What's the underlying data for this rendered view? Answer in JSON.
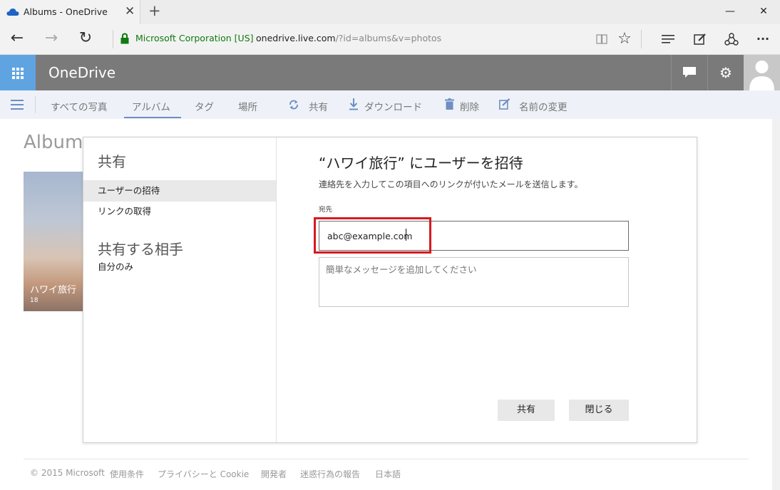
{
  "browser": {
    "tab_title": "Albums - OneDrive",
    "tab_close": "✕",
    "new_tab": "+",
    "window_controls": {
      "minimize": "—",
      "maximize": "☐",
      "close": "✕"
    },
    "nav": {
      "back": "←",
      "forward": "→",
      "refresh": "↻"
    },
    "certificate": "Microsoft Corporation [US]",
    "url_domain": "onedrive.live.com",
    "url_path": "/?id=albums&v=photos",
    "tools": {
      "reading": "📖",
      "favorite": "☆",
      "hub": "≡",
      "note": "✎",
      "share": "⇪",
      "more": "···"
    }
  },
  "header": {
    "app_name": "OneDrive",
    "chat_icon": "💬",
    "settings_icon": "⚙"
  },
  "commandbar": {
    "items": [
      "すべての写真",
      "アルバム",
      "タグ",
      "場所"
    ],
    "actions": {
      "share": "共有",
      "download": "ダウンロード",
      "delete": "削除",
      "rename": "名前の変更"
    }
  },
  "page": {
    "title": "Albums",
    "album": {
      "name": "ハワイ旅行",
      "count": "18"
    }
  },
  "dialog": {
    "left_heading": "共有",
    "nav": [
      "ユーザーの招待",
      "リンクの取得"
    ],
    "shared_with_heading": "共有する相手",
    "shared_with_value": "自分のみ",
    "title": "“ハワイ旅行” にユーザーを招待",
    "description": "連絡先を入力してこの項目へのリンクが付いたメールを送信します。",
    "to_label": "宛先",
    "to_value": "abc@example.com",
    "message_placeholder": "簡単なメッセージを追加してください",
    "share_button": "共有",
    "close_button": "閉じる"
  },
  "footer": [
    "© 2015 Microsoft",
    "使用条件",
    "プライバシーと Cookie",
    "開発者",
    "迷惑行為の報告",
    "日本語"
  ],
  "colors": {
    "accent": "#5fa4e0",
    "header": "#7a7a7a",
    "highlight": "#d71920",
    "cert_green": "#0f7a0f"
  }
}
